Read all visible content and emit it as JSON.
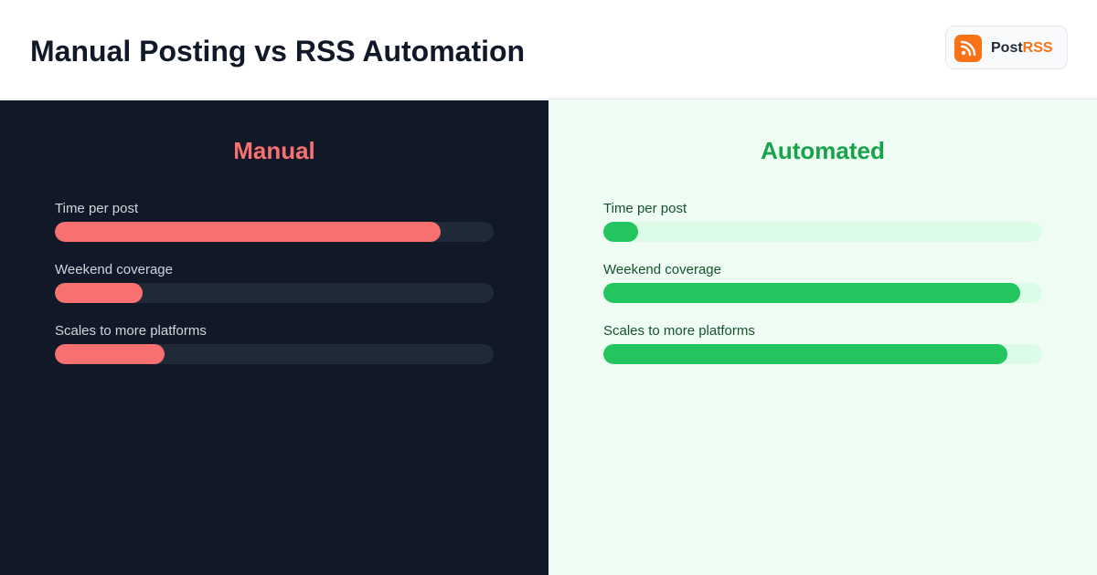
{
  "header": {
    "title": "Manual Posting vs RSS Automation",
    "brand": {
      "name_part1": "Post",
      "name_part2": "RSS",
      "icon": "rss-icon"
    }
  },
  "colors": {
    "manual_accent": "#f87171",
    "manual_bg": "#111827",
    "auto_accent": "#22c55e",
    "auto_title": "#16a34a",
    "auto_bg": "#effcf3",
    "brand": "#f97316"
  },
  "chart_data": [
    {
      "type": "bar",
      "title": "Manual",
      "categories": [
        "Time per post",
        "Weekend coverage",
        "Scales to more platforms"
      ],
      "values": [
        0.88,
        0.2,
        0.25
      ],
      "xlim": [
        0,
        1
      ]
    },
    {
      "type": "bar",
      "title": "Automated",
      "categories": [
        "Time per post",
        "Weekend coverage",
        "Scales to more platforms"
      ],
      "values": [
        0.08,
        0.95,
        0.92
      ],
      "xlim": [
        0,
        1
      ]
    }
  ]
}
